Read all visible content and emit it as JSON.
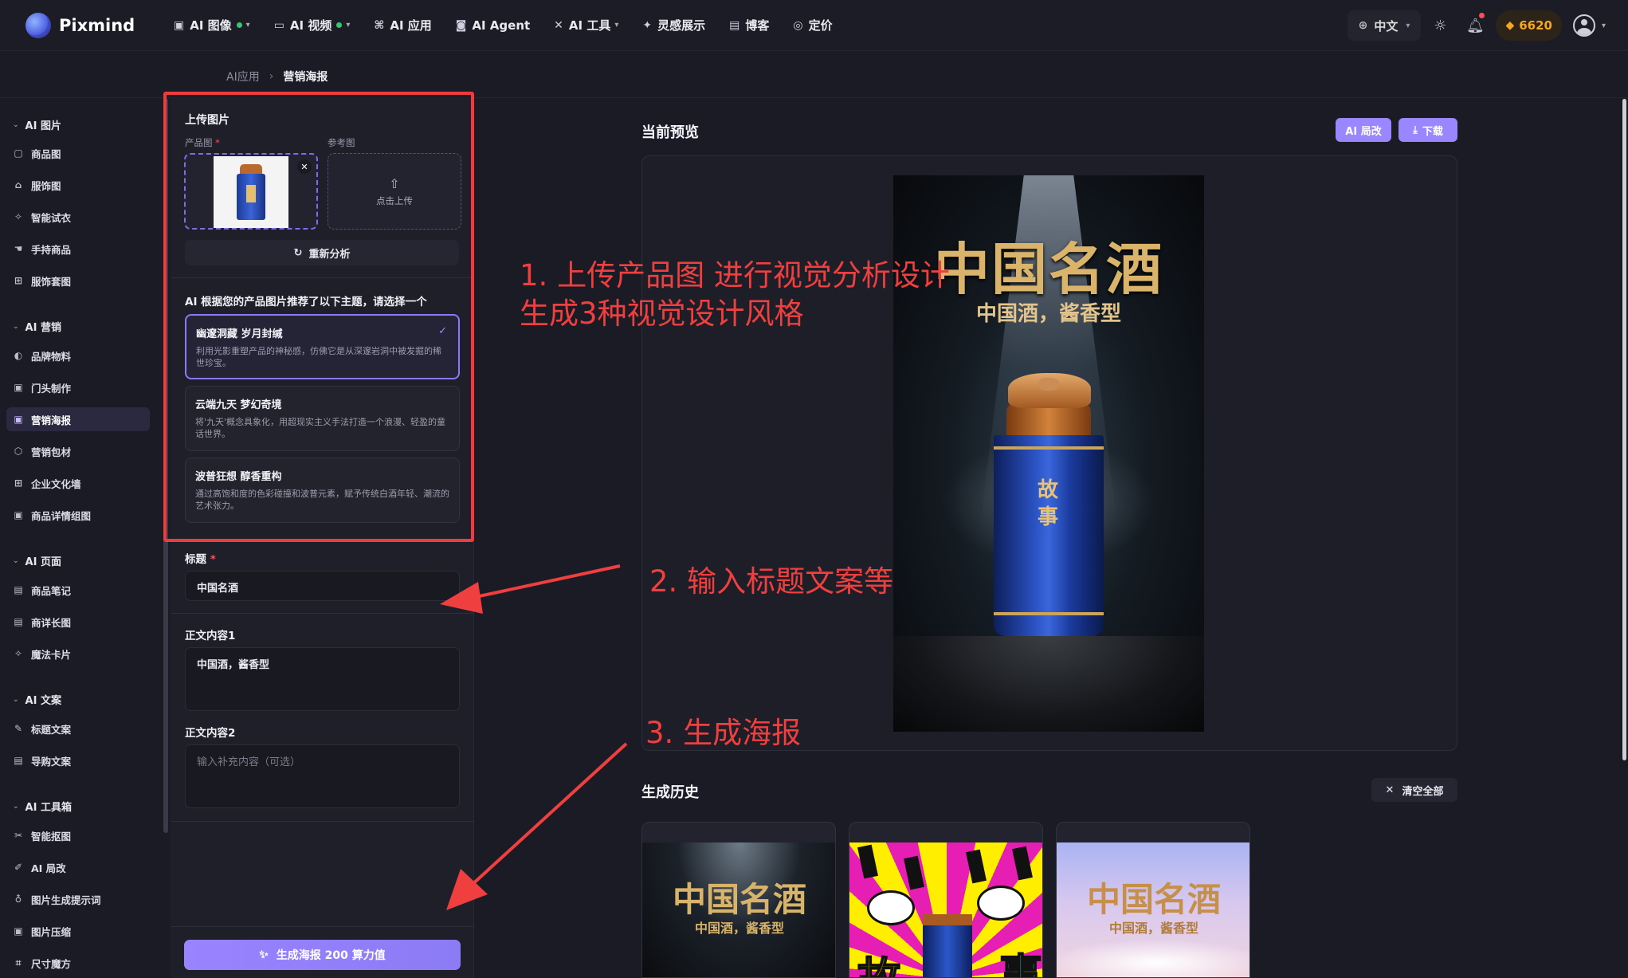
{
  "app": {
    "name": "Pixmind"
  },
  "nav": {
    "items": [
      {
        "label": "AI 图像",
        "icon": "image-icon",
        "dot": true,
        "chevron": true
      },
      {
        "label": "AI 视频",
        "icon": "video-icon",
        "dot": true,
        "chevron": true
      },
      {
        "label": "AI 应用",
        "icon": "apps-icon",
        "dot": false,
        "chevron": false
      },
      {
        "label": "AI Agent",
        "icon": "robot-icon",
        "dot": false,
        "chevron": false
      },
      {
        "label": "AI 工具",
        "icon": "tools-icon",
        "dot": false,
        "chevron": true
      },
      {
        "label": "灵感展示",
        "icon": "sparkle-icon",
        "dot": false,
        "chevron": false
      },
      {
        "label": "博客",
        "icon": "blog-icon",
        "dot": false,
        "chevron": false
      },
      {
        "label": "定价",
        "icon": "pricing-icon",
        "dot": false,
        "chevron": false
      }
    ],
    "language": "中文",
    "credits": "6620"
  },
  "breadcrumb": {
    "parent": "AI应用",
    "current": "营销海报"
  },
  "sidebar": {
    "groups": [
      {
        "title": "AI 图片",
        "items": [
          "商品图",
          "服饰图",
          "智能试衣",
          "手持商品",
          "服饰套图"
        ]
      },
      {
        "title": "AI 营销",
        "items": [
          "品牌物料",
          "门头制作",
          "营销海报",
          "营销包材",
          "企业文化墙",
          "商品详情组图"
        ]
      },
      {
        "title": "AI 页面",
        "items": [
          "商品笔记",
          "商详长图",
          "魔法卡片"
        ]
      },
      {
        "title": "AI 文案",
        "items": [
          "标题文案",
          "导购文案"
        ]
      },
      {
        "title": "AI 工具箱",
        "items": [
          "智能抠图",
          "AI 局改",
          "图片生成提示词",
          "图片压缩",
          "尺寸魔方"
        ]
      }
    ],
    "active": "营销海报"
  },
  "form": {
    "upload_title": "上传图片",
    "product_label": "产品图",
    "reference_label": "参考图",
    "upload_cta": "点击上传",
    "reanalyze_label": "重新分析",
    "themes_prompt": "AI 根据您的产品图片推荐了以下主题，请选择一个",
    "themes": [
      {
        "name": "幽邃洞藏 岁月封缄",
        "desc": "利用光影重塑产品的神秘感，仿佛它是从深邃岩洞中被发掘的稀世珍宝。",
        "selected": true
      },
      {
        "name": "云端九天 梦幻奇境",
        "desc": "将'九天'概念具象化，用超现实主义手法打造一个浪漫、轻盈的童话世界。",
        "selected": false
      },
      {
        "name": "波普狂想 醇香重构",
        "desc": "通过高饱和度的色彩碰撞和波普元素，赋予传统白酒年轻、潮流的艺术张力。",
        "selected": false
      }
    ],
    "title_label": "标题",
    "title_value": "中国名酒",
    "body1_label": "正文内容1",
    "body1_value": "中国酒，酱香型",
    "body2_label": "正文内容2",
    "body2_placeholder": "输入补充内容（可选）",
    "generate_label": "生成海报 200 算力值"
  },
  "preview": {
    "title": "当前预览",
    "ai_edit_label": "AI 局改",
    "download_label": "下载",
    "poster_title": "中国名酒",
    "poster_subtitle": "中国酒，酱香型",
    "jar_label": "故事"
  },
  "history": {
    "title": "生成历史",
    "clear_label": "清空全部",
    "items": [
      {
        "style": "dark",
        "title": "中国名酒",
        "subtitle": "中国酒，酱香型"
      },
      {
        "style": "pop",
        "title": "",
        "subtitle": "",
        "letters": [
          "故",
          "事"
        ]
      },
      {
        "style": "dream",
        "title": "中国名酒",
        "subtitle": "中国酒，酱香型"
      }
    ]
  },
  "annotations": {
    "step1_line1": "1. 上传产品图 进行视觉分析设计",
    "step1_line2": "生成3种视觉设计风格",
    "step2": "2. 输入标题文案等",
    "step3": "3. 生成海报"
  },
  "colors": {
    "accent": "#9a87ff",
    "annotation": "#ef3f3f",
    "credits": "#f5a623",
    "background": "#1b1b25"
  }
}
